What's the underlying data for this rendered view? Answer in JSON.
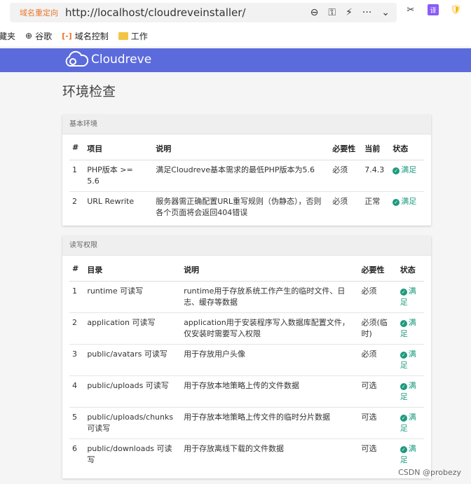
{
  "browser": {
    "redirect_label": "域名重定向",
    "url": "http://localhost/cloudreveinstaller/",
    "translate_label": "译"
  },
  "bookmarks": [
    {
      "label": "藏夹"
    },
    {
      "label": "谷歌"
    },
    {
      "label": "域名控制"
    },
    {
      "label": "工作"
    }
  ],
  "app": {
    "brand": "Cloudreve"
  },
  "page": {
    "title": "环境检查"
  },
  "basic": {
    "heading": "基本环境",
    "columns": [
      "#",
      "项目",
      "说明",
      "必要性",
      "当前",
      "状态"
    ],
    "rows": [
      {
        "no": "1",
        "item": "PHP版本 >= 5.6",
        "desc": "满足Cloudreve基本需求的最低PHP版本为5.6",
        "req": "必须",
        "cur": "7.4.3",
        "status": "满足"
      },
      {
        "no": "2",
        "item": "URL Rewrite",
        "desc": "服务器需正确配置URL重写规则（伪静态），否则各个页面将会返回404错误",
        "req": "必须",
        "cur": "正常",
        "status": "满足"
      }
    ]
  },
  "perm": {
    "heading": "读写权限",
    "columns": [
      "#",
      "目录",
      "说明",
      "必要性",
      "状态"
    ],
    "rows": [
      {
        "no": "1",
        "dir": "runtime 可读写",
        "desc": "runtime用于存放系统工作产生的临时文件、日志、缓存等数据",
        "req": "必须",
        "status": "满足"
      },
      {
        "no": "2",
        "dir": "application 可读写",
        "desc": "application用于安装程序写入数据库配置文件，仅安装时需要写入权限",
        "req": "必须(临时)",
        "status": "满足"
      },
      {
        "no": "3",
        "dir": "public/avatars 可读写",
        "desc": "用于存放用户头像",
        "req": "必须",
        "status": "满足"
      },
      {
        "no": "4",
        "dir": "public/uploads 可读写",
        "desc": "用于存放本地策略上传的文件数据",
        "req": "可选",
        "status": "满足"
      },
      {
        "no": "5",
        "dir": "public/uploads/chunks 可读写",
        "desc": "用于存放本地策略上传文件的临时分片数据",
        "req": "可选",
        "status": "满足"
      },
      {
        "no": "6",
        "dir": "public/downloads 可读写",
        "desc": "用于存放离线下载的文件数据",
        "req": "可选",
        "status": "满足"
      }
    ]
  },
  "watermark": "CSDN @probezy",
  "colors": {
    "header": "#5b6bdc",
    "ok": "#1c9a7e",
    "redirect": "#e8762b"
  }
}
